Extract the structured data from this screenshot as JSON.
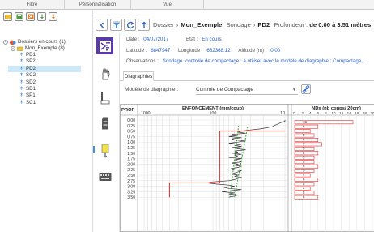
{
  "tabs": [
    "Filtre",
    "Personnalisation",
    "Vue"
  ],
  "tree": {
    "root": "Dossiers en cours (1)",
    "folder": "Mon_Exemple (8)",
    "items": [
      "PD1",
      "SP2",
      "PD2",
      "SC2",
      "SD2",
      "SD1",
      "SP1",
      "SC1"
    ],
    "selected": "PD2"
  },
  "breadcrumb": {
    "dossier_label": "Dossier",
    "dossier": "Mon_Exemple",
    "sondage_label": "Sondage",
    "sondage": "PD2",
    "profondeur_label": "Profondeur :",
    "profondeur": "de 0.00 à 3.51 mètres"
  },
  "fields": {
    "date_label": "Date :",
    "date": "04/07/2017",
    "etat_label": "Etat :",
    "etat": "En cours",
    "latitude_label": "Latitude :",
    "latitude": "6847947",
    "longitude_label": "Longitude :",
    "longitude": "632368.12",
    "altitude_label": "Altitude (m) :",
    "altitude": "0.00",
    "observations_label": "Observations :",
    "observations": "Sondage ·contrôle de compactage : à utiliser avec le modèle de diagraphie : Compactage, ..."
  },
  "panel_tab": "Diagraphies",
  "model": {
    "label": "Modèle de diagraphie :",
    "value": "Contrôle de Compactage"
  },
  "colors": {
    "active_icon": "#5a3aa8",
    "link": "#2a5ec2",
    "red": "#e03030",
    "green": "#2ea02e",
    "grey_curve": "#333333"
  },
  "icons": [
    "folder-icon",
    "save-icon",
    "delete-icon",
    "shovel-icon",
    "settings-icon",
    "back-icon",
    "filter-icon",
    "refresh-icon",
    "up-icon"
  ],
  "chart_data": [
    {
      "type": "line",
      "title": "ENFONCEMENT (mm/coup)",
      "ylabel": "PROF",
      "xscale": "log",
      "xlim": [
        1000,
        10
      ],
      "xticks": [
        "1000",
        "100",
        "10"
      ],
      "yticks": [
        "0.00",
        "0.25",
        "0.50",
        "0.75",
        "1.00",
        "1.25",
        "1.50",
        "1.75",
        "2.00",
        "2.25",
        "2.50",
        "2.75",
        "3.00",
        "3.25",
        "3.50"
      ],
      "ylim": [
        0,
        3.5
      ],
      "series": [
        {
          "color": "#333333",
          "depth": [
            0,
            0.05,
            0.1,
            0.15,
            0.2,
            0.25,
            0.3,
            0.35,
            0.4,
            0.45,
            0.5,
            0.55,
            0.6,
            0.65,
            0.7,
            0.75,
            0.8,
            0.85,
            0.9,
            0.95,
            1.0,
            1.05,
            1.1,
            1.15,
            1.2,
            1.25,
            1.3,
            1.35,
            1.4,
            1.45,
            1.5,
            1.55,
            1.6,
            1.65,
            1.7,
            1.75,
            1.8,
            1.85,
            1.9,
            1.95,
            2.0,
            2.05,
            2.1,
            2.15,
            2.2,
            2.25,
            2.3,
            2.35,
            2.4,
            2.45,
            2.5,
            2.55,
            2.6,
            2.65,
            2.7,
            2.75,
            2.8,
            2.85,
            2.9,
            2.95,
            3.0,
            3.05,
            3.1,
            3.15,
            3.2,
            3.25,
            3.3,
            3.35,
            3.4,
            3.45,
            3.5
          ],
          "value": [
            10,
            10,
            11,
            12,
            13,
            14,
            15,
            18,
            22,
            30,
            40,
            45,
            35,
            55,
            45,
            60,
            40,
            55,
            50,
            35,
            45,
            60,
            40,
            50,
            40,
            55,
            45,
            35,
            50,
            45,
            55,
            40,
            50,
            45,
            60,
            40,
            50,
            45,
            40,
            55,
            45,
            50,
            40,
            45,
            55,
            50,
            40,
            45,
            50,
            55,
            45,
            50,
            40,
            45,
            50,
            60,
            100,
            120,
            90,
            60,
            50,
            70,
            60,
            40,
            55,
            75,
            50,
            60,
            45,
            50,
            60
          ]
        },
        {
          "color": "#2ea02e",
          "dashed": true,
          "depth": [
            0.25,
            3.5
          ],
          "value": [
            44,
            58
          ]
        },
        {
          "color": "#2ea02e",
          "dashed": true,
          "depth": [
            0.3,
            3.5
          ],
          "value": [
            33,
            50
          ]
        },
        {
          "color": "#e03030",
          "depth": [
            0.5,
            0.5,
            2.85,
            2.85,
            3.5
          ],
          "value": [
            10,
            80,
            80,
            400,
            400
          ]
        }
      ]
    },
    {
      "type": "bar",
      "title": "NDx (nb coups/ 20cm)",
      "xticks": [
        "2",
        "4",
        "6",
        "8",
        "10",
        "12",
        "14",
        "16",
        "18",
        "20"
      ],
      "xlim": [
        0,
        20
      ],
      "categories_depth": [
        0.1,
        0.3,
        0.5,
        0.7,
        0.9,
        1.1,
        1.3,
        1.5,
        1.7,
        1.9,
        2.1,
        2.3,
        2.5,
        2.7,
        2.9,
        3.1,
        3.3,
        3.5
      ],
      "values": [
        15,
        6,
        4,
        5,
        6,
        7,
        5,
        6,
        5,
        5,
        6,
        5,
        4,
        6,
        5,
        4,
        5,
        6
      ]
    }
  ]
}
